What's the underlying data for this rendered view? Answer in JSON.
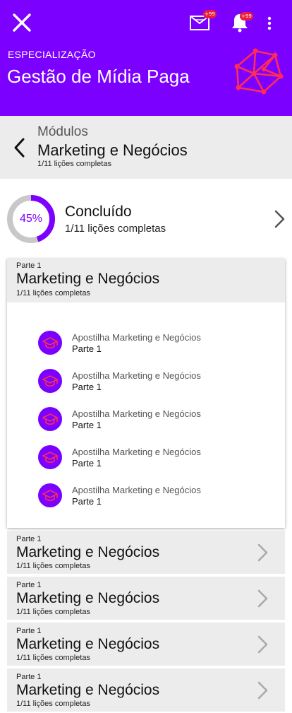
{
  "header": {
    "kicker": "ESPECIALIZAÇÃO",
    "title": "Gestão de Mídia Paga",
    "mail_badge": "+99",
    "bell_badge": "+99",
    "background_color": "#7b00ff",
    "icons": [
      "close-icon",
      "mail-icon",
      "bell-icon",
      "more-vertical-icon",
      "network-icon"
    ]
  },
  "module": {
    "kicker": "Módulos",
    "title": "Marketing e Negócios",
    "subtitle": "1/11 lições completas"
  },
  "progress": {
    "percent_label": "45%",
    "percent_value": 45,
    "label": "Concluído",
    "subtitle": "1/11 lições completas"
  },
  "expanded_section": {
    "part": "Parte 1",
    "title": "Marketing e Negócios",
    "subtitle": "1/11 lições completas",
    "lessons": [
      {
        "title": "Apostilha Marketing e Negócios",
        "part": "Parte 1"
      },
      {
        "title": "Apostilha Marketing e Negócios",
        "part": "Parte 1"
      },
      {
        "title": "Apostilha Marketing e Negócios",
        "part": "Parte 1"
      },
      {
        "title": "Apostilha Marketing e Negócios",
        "part": "Parte 1"
      },
      {
        "title": "Apostilha Marketing e Negócios",
        "part": "Parte 1"
      }
    ]
  },
  "collapsed_sections": [
    {
      "part": "Parte 1",
      "title": "Marketing e Negócios",
      "subtitle": "1/11 lições completas"
    },
    {
      "part": "Parte 1",
      "title": "Marketing e Negócios",
      "subtitle": "1/11 lições completas"
    },
    {
      "part": "Parte 1",
      "title": "Marketing e Negócios",
      "subtitle": "1/11 lições completas"
    },
    {
      "part": "Parte 1",
      "title": "Marketing e Negócios",
      "subtitle": "1/11 lições completas"
    }
  ],
  "colors": {
    "accent": "#7b00ff",
    "badge": "#e81c3c",
    "network_icon": "#ff2d55",
    "panel": "#ececec"
  }
}
